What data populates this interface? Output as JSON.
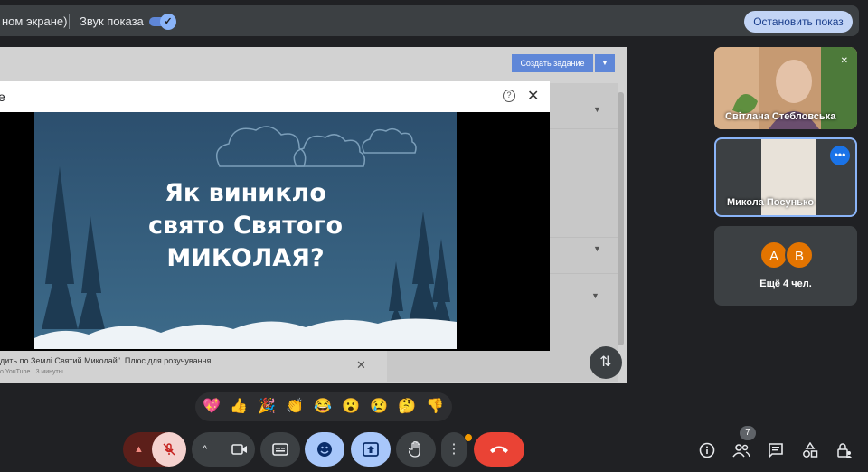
{
  "share_bar": {
    "mode_text": "ном экране)",
    "sound_label": "Звук показа",
    "sound_on": true,
    "stop_label": "Остановить показ"
  },
  "shared_screen": {
    "create_task": "Создать задание",
    "caption_title": "дить по Землі Святий Миколай\". Плюс для розучування",
    "caption_meta": "о YouTube · 3 минуты"
  },
  "video_popup": {
    "title_fragment": "е",
    "video_title_line1": "Як виникло",
    "video_title_line2": "свято Святого",
    "video_title_line3": "МИКОЛАЯ?"
  },
  "participants": {
    "p1": "Світлана Стебловська",
    "p2": "Микола Посунько",
    "others_count_text": "Ещё 4 чел.",
    "avatar_a": "A",
    "avatar_b": "B"
  },
  "reactions": [
    "💖",
    "👍",
    "🎉",
    "👏",
    "😂",
    "😮",
    "😢",
    "🤔",
    "👎"
  ],
  "toolbar": {
    "people_count": "7"
  },
  "colors": {
    "background": "#202124",
    "accent": "#8ab4f8",
    "leave": "#ea4335",
    "avatar": "#e37400"
  }
}
